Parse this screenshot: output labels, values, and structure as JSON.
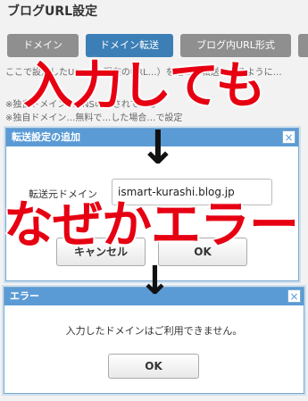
{
  "page": {
    "title": "ブログURL設定",
    "tabs": [
      {
        "label": "ドメイン"
      },
      {
        "label": "ドメイン転送"
      },
      {
        "label": "ブログ内URL形式"
      }
    ],
    "bg_line1": "ここで設定したURL（…現在のURL…）を他の…転送されるように…",
    "bg_line2": "※独自ドメイン…DNSの…されている",
    "bg_line3": "※独自ドメイン…無料で…した場合…で設定"
  },
  "transfer_dialog": {
    "title": "転送設定の追加",
    "close_icon": "×",
    "label": "転送元ドメイン",
    "input_value": "ismart-kurashi.blog.jp",
    "cancel_label": "キャンセル",
    "ok_label": "OK"
  },
  "error_dialog": {
    "title": "エラー",
    "close_icon": "×",
    "message": "入力したドメインはご利用できません。",
    "ok_label": "OK"
  },
  "overlay": {
    "caption1": "入力しても",
    "caption2": "なぜかエラー",
    "arrow": "↓",
    "color": "#e60012"
  }
}
